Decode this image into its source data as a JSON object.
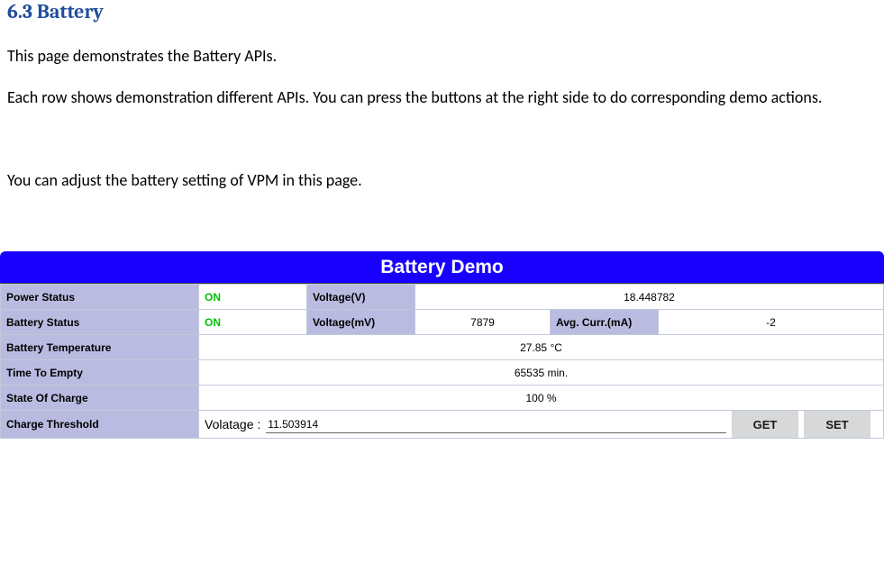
{
  "heading": "6.3 Battery",
  "para1": "This page demonstrates the Battery APIs.",
  "para2": "Each row shows demonstration different APIs. You can press the buttons at the right side to do corresponding demo actions.",
  "para3": "You can adjust the battery setting of VPM in this page.",
  "panel": {
    "title": "Battery Demo",
    "labels": {
      "power_status": "Power Status",
      "battery_status": "Battery Status",
      "battery_temp": "Battery Temperature",
      "time_to_empty": "Time To Empty",
      "state_of_charge": "State Of Charge",
      "charge_threshold": "Charge Threshold",
      "voltage_v": "Voltage(V)",
      "voltage_mv": "Voltage(mV)",
      "avg_curr": "Avg. Curr.(mA)",
      "volatage": "Volatage :"
    },
    "values": {
      "power_status": "ON",
      "battery_status": "ON",
      "voltage_v": "18.448782",
      "voltage_mv": "7879",
      "avg_curr": "-2",
      "battery_temp": "27.85  °C",
      "time_to_empty": "65535   min.",
      "state_of_charge": "100   %",
      "threshold_input": "11.503914"
    },
    "buttons": {
      "get": "GET",
      "set": "SET"
    }
  }
}
